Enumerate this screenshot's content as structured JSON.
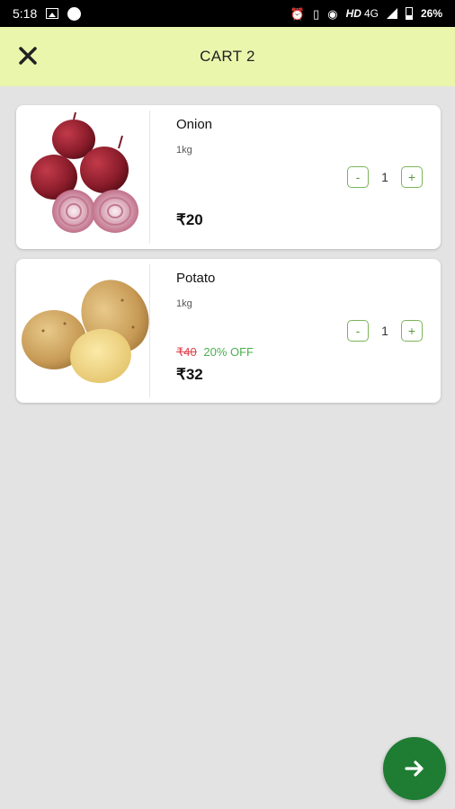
{
  "status_bar": {
    "time": "5:18",
    "network": "HD",
    "network_type": "4G",
    "battery": "26%",
    "icons": [
      "image-icon",
      "circle-icon",
      "alarm-icon",
      "vibrate-icon",
      "hotspot-icon",
      "signal-icon",
      "battery-icon"
    ]
  },
  "header": {
    "title": "CART 2",
    "close_icon": "close-icon"
  },
  "cart": {
    "items": [
      {
        "name": "Onion",
        "unit": "1kg",
        "quantity": "1",
        "price": "₹20",
        "decrement_label": "-",
        "increment_label": "+"
      },
      {
        "name": "Potato",
        "unit": "1kg",
        "quantity": "1",
        "old_price": "₹40",
        "discount": "20% OFF",
        "price": "₹32",
        "decrement_label": "-",
        "increment_label": "+"
      }
    ]
  },
  "fab": {
    "icon": "arrow-right-icon"
  },
  "colors": {
    "header_bg": "#eaf6ac",
    "page_bg": "#e3e3e3",
    "accent_green": "#1e7d33",
    "strike_red": "#e0424f",
    "discount_green": "#4caf50"
  }
}
